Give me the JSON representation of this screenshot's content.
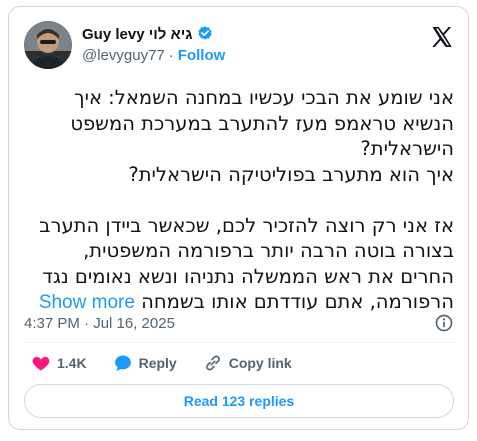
{
  "author": {
    "display_name": "Guy levy גיא לוי",
    "handle": "@levyguy77",
    "separator": "·",
    "follow_label": "Follow"
  },
  "tweet": {
    "lines": [
      "אני שומע את הבכי עכשיו במחנה השמאל: איך",
      "הנשיא טראמפ מעז להתערב במערכת המשפט",
      "הישראלית?",
      "איך הוא מתערב בפוליטיקה הישראלית?",
      "",
      "אז אני רק רוצה להזכיר לכם, שכאשר ביידן התערב",
      "בצורה בוטה הרבה יותר ברפורמה המשפטית,",
      "החרים את ראש הממשלה נתניהו ונשא נאומים נגד",
      "הרפורמה, אתם עודדתם אותו בשמחה"
    ],
    "show_more_label": "Show more"
  },
  "meta": {
    "timestamp": "4:37 PM · Jul 16, 2025"
  },
  "actions": {
    "likes": "1.4K",
    "reply_label": "Reply",
    "copy_link_label": "Copy link"
  },
  "read_replies_label": "Read 123 replies",
  "colors": {
    "accent": "#1d9bf0",
    "heart": "#f91880",
    "muted": "#536471",
    "text": "#0f1419",
    "border": "#cfd9de"
  },
  "icons": [
    "verified-badge-icon",
    "x-logo-icon",
    "info-icon",
    "heart-icon",
    "reply-bubble-icon",
    "link-icon"
  ]
}
